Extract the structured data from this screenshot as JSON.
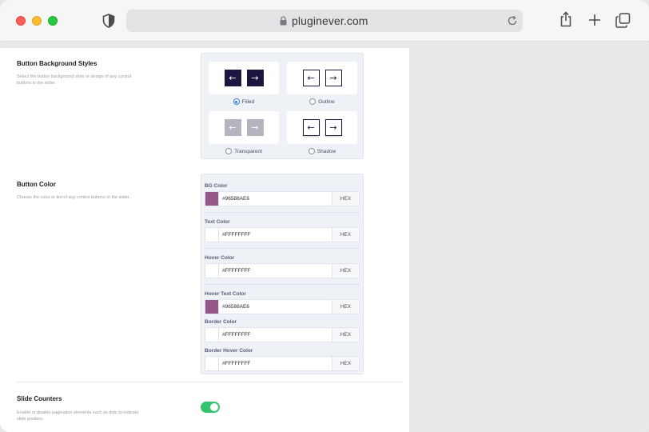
{
  "browser": {
    "url": "pluginever.com",
    "icons": [
      "shield-icon",
      "lock-icon",
      "reload-icon",
      "share-icon",
      "plus-icon",
      "tabs-icon"
    ]
  },
  "sections": {
    "button_bg_styles": {
      "title": "Button Background Styles",
      "description": "Select the button background style or design of any control buttons in the slider.",
      "selected": "Filled",
      "options": [
        {
          "label": "Filled",
          "prev": "←",
          "next": "→",
          "checked": true
        },
        {
          "label": "Outline",
          "prev": "←",
          "next": "→",
          "checked": false
        },
        {
          "label": "Transparent",
          "prev": "←",
          "next": "→",
          "checked": false
        },
        {
          "label": "Shadow",
          "prev": "←",
          "next": "→",
          "checked": false
        }
      ]
    },
    "button_color": {
      "title": "Button Color",
      "description": "Choose the color or tint of any control buttons in the slider.",
      "hex_label": "HEX",
      "fields": [
        {
          "label": "BG Color",
          "value": "#96588AE6",
          "swatch": "#96588a"
        },
        {
          "label": "Text Color",
          "value": "#FFFFFFFF",
          "swatch": "#ffffff"
        },
        {
          "label": "Hover Color",
          "value": "#FFFFFFFF",
          "swatch": "#ffffff"
        },
        {
          "label": "Hover Text Color",
          "value": "#96588AE6",
          "swatch": "#96588a"
        },
        {
          "label": "Border Color",
          "value": "#FFFFFFFF",
          "swatch": "#ffffff"
        },
        {
          "label": "Border Hover Color",
          "value": "#FFFFFFFF",
          "swatch": "#ffffff"
        }
      ]
    },
    "slide_counters": {
      "title": "Slide Counters",
      "description": "Enable or disable pagination elements such as dots to indicate slide position.",
      "enabled": true
    }
  },
  "colors": {
    "filled_button": "#1b1640",
    "toggle_on": "#34c46e",
    "radio_checked": "#2b7bd8"
  }
}
